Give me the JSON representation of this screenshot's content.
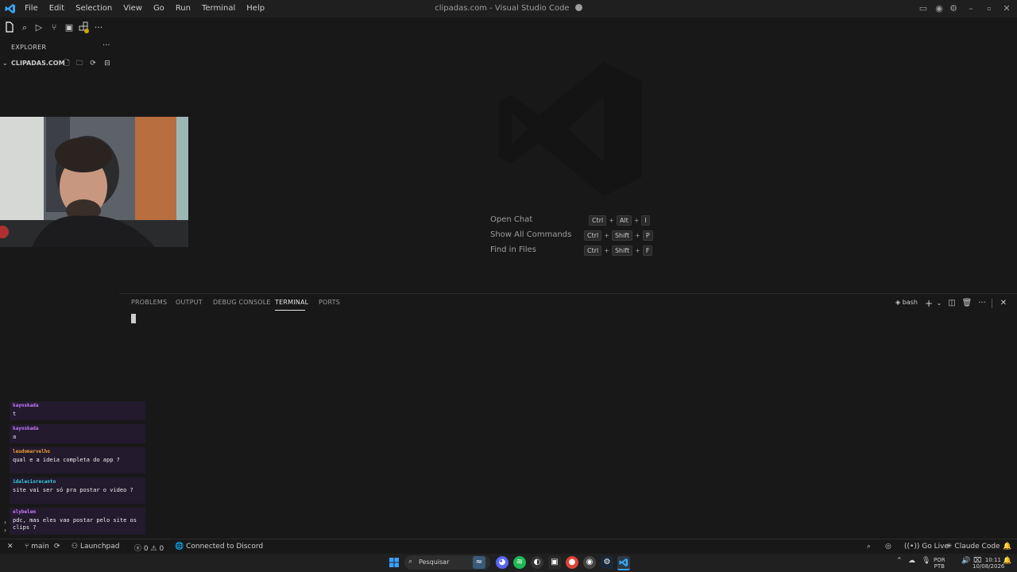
{
  "titlebar": {
    "menus": [
      "File",
      "Edit",
      "Selection",
      "View",
      "Go",
      "Run",
      "Terminal",
      "Help"
    ],
    "title": "clipadas.com - Visual Studio Code"
  },
  "sidebar": {
    "explorer_title": "EXPLORER",
    "more": "···",
    "folder_name": "CLIPADAS.COM"
  },
  "shortcuts": [
    {
      "label": "Open Chat",
      "keys": [
        "Ctrl",
        "Alt",
        "I"
      ]
    },
    {
      "label": "Show All Commands",
      "keys": [
        "Ctrl",
        "Shift",
        "P"
      ]
    },
    {
      "label": "Find in Files",
      "keys": [
        "Ctrl",
        "Shift",
        "F"
      ]
    }
  ],
  "panel": {
    "tabs": [
      "PROBLEMS",
      "OUTPUT",
      "DEBUG CONSOLE",
      "TERMINAL",
      "PORTS"
    ],
    "active_tab": "TERMINAL",
    "shell": "bash"
  },
  "chat": [
    {
      "user": "kayoskada",
      "color": "#c77dff",
      "text": "t"
    },
    {
      "user": "kayoskada",
      "color": "#c77dff",
      "text": "a"
    },
    {
      "user": "leudomarvelho",
      "color": "#f0a030",
      "text": "qual e a ideia completa do app ?"
    },
    {
      "user": "idaleciorecanto",
      "color": "#35d0e0",
      "text": "site vai ser só pra postar o video ?"
    },
    {
      "user": "elybelem",
      "color": "#c77dff",
      "text": "pdc, mas eles vao postar pelo site os clips ?"
    }
  ],
  "statusbar": {
    "branch": "main",
    "launchpad": "Launchpad",
    "errors": "0",
    "warnings": "0",
    "discord": "Connected to Discord",
    "go_live": "Go Live",
    "claude": "Claude Code"
  },
  "taskbar": {
    "search": "Pesquisar",
    "lang_top": "POR",
    "lang_bottom": "PTB",
    "time": "10:11",
    "date": "10/08/2026"
  }
}
